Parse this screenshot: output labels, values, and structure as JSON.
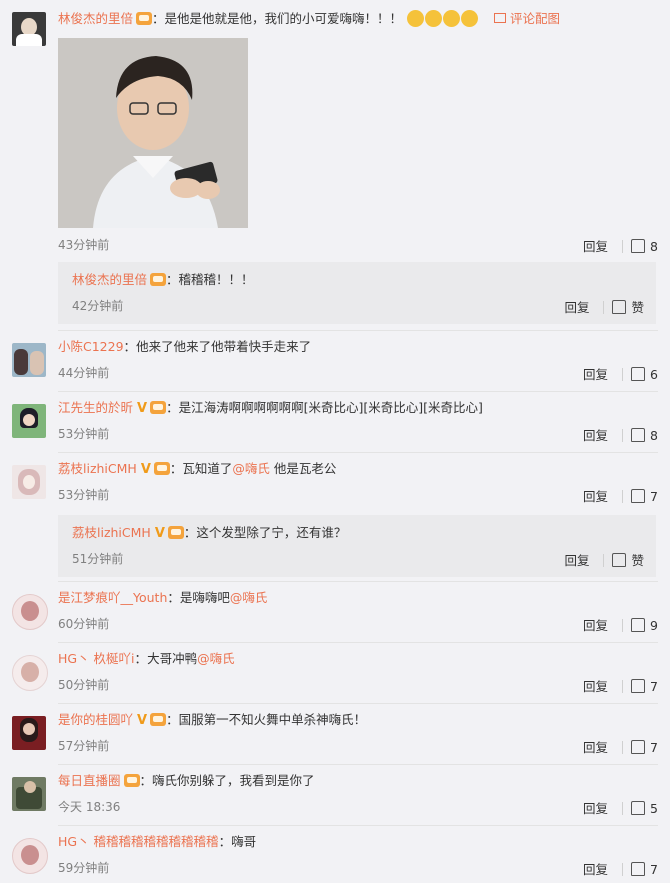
{
  "comments": [
    {
      "user": "林俊杰的里倍",
      "text": "是他是他就是他，我们的小可爱嗨嗨！！！",
      "pic_link": "评论配图",
      "time": "43分钟前",
      "reply": "回复",
      "likes": "8",
      "sub": {
        "user": "林俊杰的里倍",
        "text": "稽稽稽！！！",
        "time": "42分钟前",
        "reply": "回复",
        "like": "赞"
      }
    },
    {
      "user": "小陈C1229",
      "text": "他来了他来了他带着快手走来了",
      "time": "44分钟前",
      "reply": "回复",
      "likes": "6"
    },
    {
      "user": "江先生的於昕",
      "text": "是江海涛啊啊啊啊啊啊[米奇比心][米奇比心][米奇比心]",
      "time": "53分钟前",
      "reply": "回复",
      "likes": "8"
    },
    {
      "user": "荔枝lizhiCMH",
      "text_before": "瓦知道了",
      "at": "@嗨氏",
      "text_after": " 他是瓦老公",
      "time": "53分钟前",
      "reply": "回复",
      "likes": "7",
      "sub": {
        "user": "荔枝lizhiCMH",
        "text": "这个发型除了宁，还有谁？",
        "time": "51分钟前",
        "reply": "回复",
        "like": "赞"
      }
    },
    {
      "user": "是江梦痕吖__Youth",
      "text": "是嗨嗨吧",
      "at": "@嗨氏",
      "time": "60分钟前",
      "reply": "回复",
      "likes": "9"
    },
    {
      "user": "HG丶 杦梴吖i",
      "text": "大哥冲鸭",
      "at": "@嗨氏",
      "time": "50分钟前",
      "reply": "回复",
      "likes": "7"
    },
    {
      "user": "是你的桂圆吖",
      "text": "国服第一不知火舞中单杀神嗨氏！",
      "time": "57分钟前",
      "reply": "回复",
      "likes": "7"
    },
    {
      "user": "每日直播圈",
      "text": "嗨氏你别躲了，我看到是你了",
      "time": "今天 18:36",
      "reply": "回复",
      "likes": "5"
    },
    {
      "user": "HG丶 稽稽稽稽稽稽稽稽稽稽",
      "text": "嗨哥",
      "time": "59分钟前",
      "reply": "回复",
      "likes": "7"
    }
  ],
  "colors": {
    "username": "#eb7350",
    "text": "#333333",
    "time": "#808080",
    "bg": "#f2f2f5",
    "subbg": "#eaeaec"
  },
  "icons": [
    "crown-badge-icon",
    "v-badge-icon",
    "emoji-icon",
    "picture-icon",
    "thumb-up-icon"
  ]
}
